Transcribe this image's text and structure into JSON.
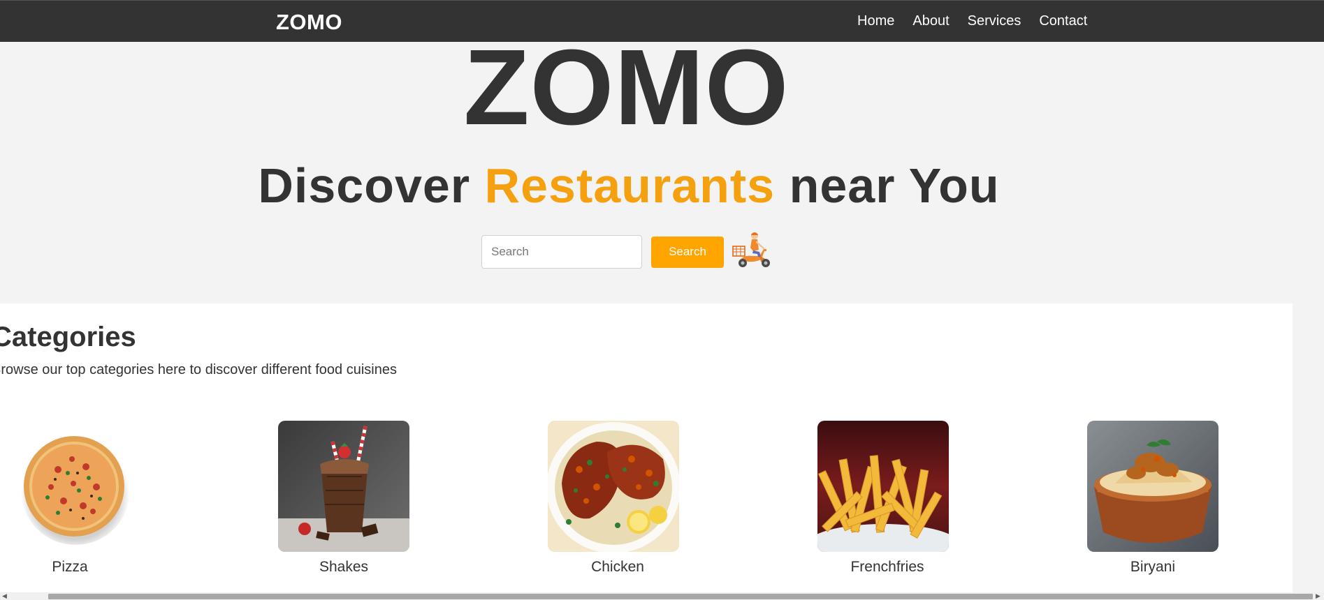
{
  "navbar": {
    "brand": "ZOMO",
    "links": [
      "Home",
      "About",
      "Services",
      "Contact"
    ]
  },
  "hero": {
    "title": "ZOMO",
    "tagline_pre": "Discover ",
    "tagline_accent": "Restaurants",
    "tagline_post": " near You",
    "search_placeholder": "Search",
    "search_value": "",
    "search_button": "Search",
    "illustration_icon": "delivery-scooter-icon"
  },
  "categories": {
    "heading": "Categories",
    "subtitle": "Browse our top categories here to discover different food cuisines",
    "items": [
      {
        "label": "Pizza",
        "image": "pizza-image"
      },
      {
        "label": "Shakes",
        "image": "chocolate-shake-image"
      },
      {
        "label": "Chicken",
        "image": "roast-chicken-image"
      },
      {
        "label": "Frenchfries",
        "image": "french-fries-image"
      },
      {
        "label": "Biryani",
        "image": "biryani-image"
      }
    ]
  },
  "colors": {
    "navbar_bg": "#333333",
    "accent": "#ffa500",
    "tagline_accent": "#f5a00e",
    "page_bg": "#f3f3f3",
    "text": "#333333"
  }
}
